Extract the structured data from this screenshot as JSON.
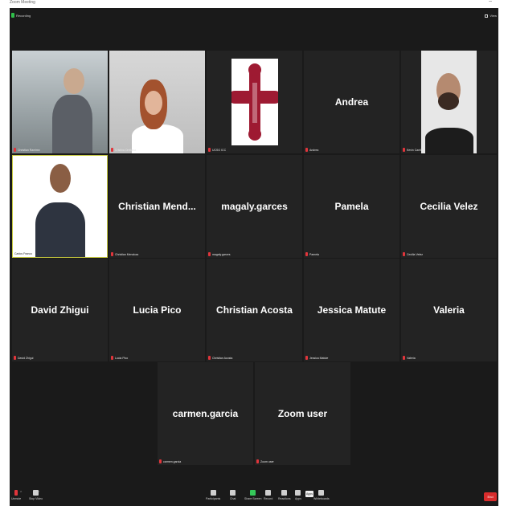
{
  "window": {
    "title": "Zoom Meeting"
  },
  "topbar": {
    "recording_label": "Recording",
    "view_label": "View"
  },
  "tiles": [
    {
      "name": "Christian Ramirez",
      "kind": "video"
    },
    {
      "name": "Cristina Orellana",
      "kind": "video"
    },
    {
      "name": "UCSG ICC",
      "kind": "logo"
    },
    {
      "name": "Andrea",
      "caption": "Andrea",
      "kind": "text"
    },
    {
      "name": "Kevin Carrillo",
      "kind": "video"
    },
    {
      "name": "Carlos Franco",
      "kind": "video"
    },
    {
      "name": "Christian  Mend...",
      "caption": "Christian Mendoza",
      "kind": "text"
    },
    {
      "name": "magaly.garces",
      "caption": "magaly.garces",
      "kind": "text"
    },
    {
      "name": "Pamela",
      "caption": "Pamela",
      "kind": "text"
    },
    {
      "name": "Cecilia Velez",
      "caption": "Cecilia Velez",
      "kind": "text"
    },
    {
      "name": "David Zhigui",
      "caption": "David Zhigui",
      "kind": "text"
    },
    {
      "name": "Lucia Pico",
      "caption": "Lucia Pico",
      "kind": "text"
    },
    {
      "name": "Christian Acosta",
      "caption": "Christian Acosta",
      "kind": "text"
    },
    {
      "name": "Jessica Matute",
      "caption": "Jessica Matute",
      "kind": "text"
    },
    {
      "name": "Valeria",
      "caption": "Valeria",
      "kind": "text"
    },
    {
      "name": "carmen.garcia",
      "caption": "carmen.garcia",
      "kind": "text"
    },
    {
      "name": "Zoom user",
      "caption": "Zoom user",
      "kind": "text"
    }
  ],
  "toolbar": {
    "unmute": "Unmute",
    "stop_video": "Stop Video",
    "participants": "Participants",
    "chat": "Chat",
    "share_screen": "Share Screen",
    "record": "Record",
    "reactions": "Reactions",
    "apps": "Apps",
    "whiteboards": "Whiteboards",
    "apps_tip": "Apps",
    "end": "End"
  },
  "colors": {
    "active_border": "#c7c93e",
    "end_button": "#d82c2c",
    "share_green": "#35c85a",
    "mic_muted": "#e0353b"
  }
}
